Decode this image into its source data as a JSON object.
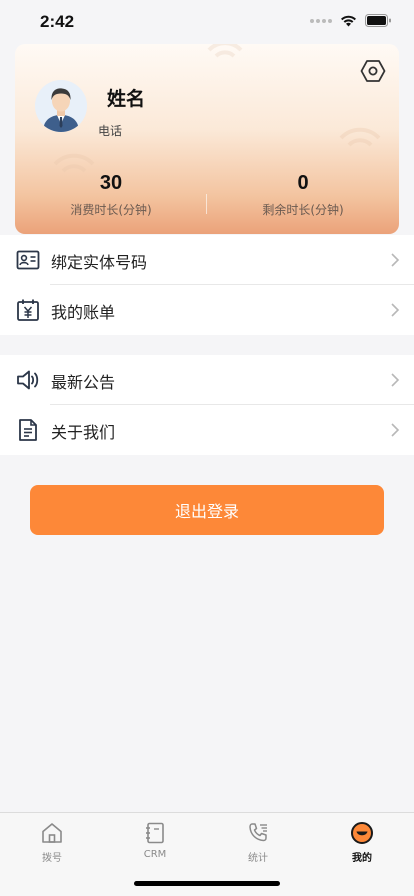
{
  "status_bar": {
    "time": "2:42"
  },
  "profile": {
    "name": "姓名",
    "phone": "电话",
    "stats": [
      {
        "value": "30",
        "label": "消费时长(分钟)"
      },
      {
        "value": "0",
        "label": "剩余时长(分钟)"
      }
    ],
    "icons": {
      "settings": "hexagon-settings-icon",
      "avatar": "user-avatar"
    }
  },
  "menu_group_1": [
    {
      "label": "绑定实体号码",
      "icon": "id-card-icon"
    },
    {
      "label": "我的账单",
      "icon": "bill-calendar-icon"
    }
  ],
  "menu_group_2": [
    {
      "label": "最新公告",
      "icon": "speaker-icon"
    },
    {
      "label": "关于我们",
      "icon": "document-icon"
    }
  ],
  "logout": {
    "label": "退出登录"
  },
  "tab_bar": [
    {
      "label": "拨号",
      "icon": "home-icon",
      "active": false
    },
    {
      "label": "CRM",
      "icon": "notebook-icon",
      "active": false
    },
    {
      "label": "统计",
      "icon": "phone-list-icon",
      "active": false
    },
    {
      "label": "我的",
      "icon": "smiley-icon",
      "active": true
    }
  ],
  "colors": {
    "accent": "#fd8838",
    "card_gradient_top": "#fffaf5",
    "card_gradient_bottom": "#eba27a",
    "background": "#f5f5f7"
  }
}
